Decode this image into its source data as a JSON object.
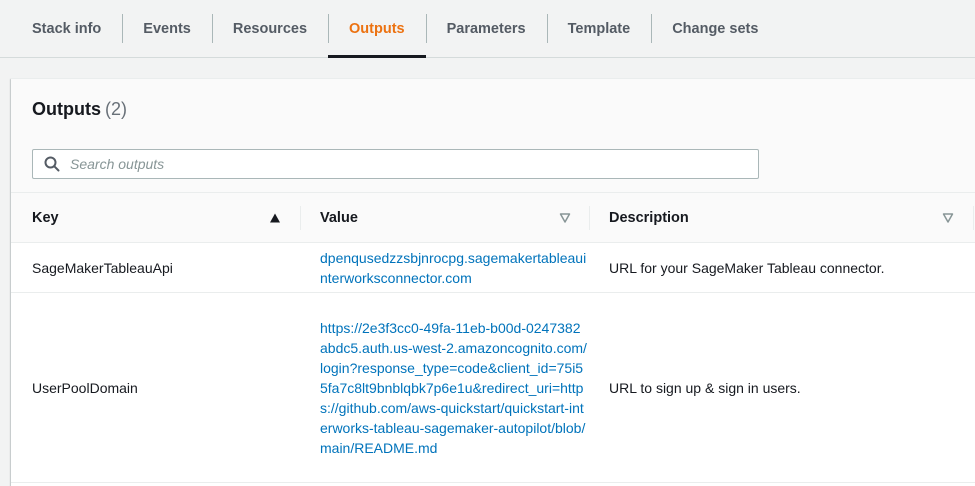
{
  "tabs": [
    {
      "label": "Stack info",
      "active": false
    },
    {
      "label": "Events",
      "active": false
    },
    {
      "label": "Resources",
      "active": false
    },
    {
      "label": "Outputs",
      "active": true
    },
    {
      "label": "Parameters",
      "active": false
    },
    {
      "label": "Template",
      "active": false
    },
    {
      "label": "Change sets",
      "active": false
    }
  ],
  "panel": {
    "title": "Outputs",
    "count": "(2)",
    "search_placeholder": "Search outputs"
  },
  "table": {
    "columns": {
      "key": "Key",
      "value": "Value",
      "description": "Description"
    },
    "rows": [
      {
        "key": "SageMakerTableauApi",
        "value": "dpenqusedzzsbjnrocpg.sagemakertableauinterworksconnector.com",
        "description": "URL for your SageMaker Tableau connector."
      },
      {
        "key": "UserPoolDomain",
        "value": "https://2e3f3cc0-49fa-11eb-b00d-0247382abdc5.auth.us-west-2.amazoncognito.com/login?response_type=code&client_id=75i55fa7c8lt9bnblqbk7p6e1u&redirect_uri=https://github.com/aws-quickstart/quickstart-interworks-tableau-sagemaker-autopilot/blob/main/README.md",
        "description": "URL to sign up & sign in users."
      }
    ]
  },
  "colors": {
    "accent": "#ec7211",
    "link": "#0073bb",
    "text": "#16191f"
  }
}
